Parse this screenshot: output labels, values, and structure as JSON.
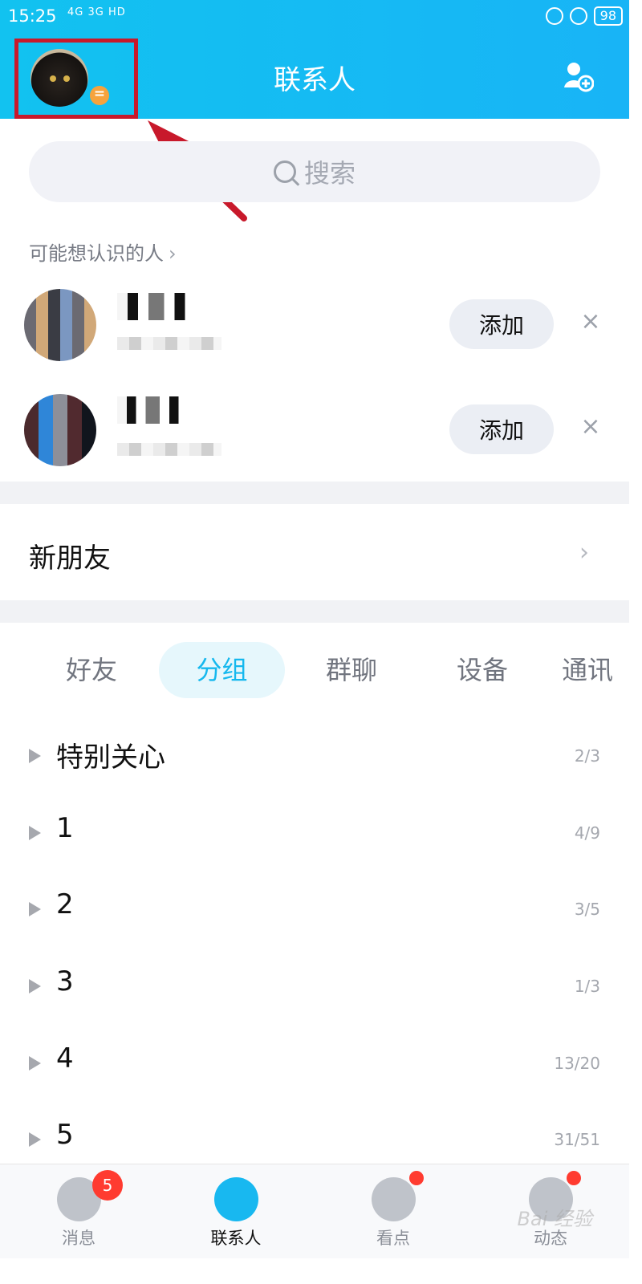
{
  "status_bar": {
    "time": "15:25",
    "signals": "4G 3G HD",
    "battery": "98"
  },
  "header": {
    "title": "联系人"
  },
  "search": {
    "placeholder": "搜索"
  },
  "suggestions": {
    "title": "可能想认识的人",
    "items": [
      {
        "button": "添加"
      },
      {
        "button": "添加"
      }
    ]
  },
  "new_friends": {
    "label": "新朋友"
  },
  "tabs": [
    "好友",
    "分组",
    "群聊",
    "设备",
    "通讯"
  ],
  "groups": [
    {
      "name": "特别关心",
      "count": "2/3"
    },
    {
      "name": "1",
      "count": "4/9"
    },
    {
      "name": "2",
      "count": "3/5"
    },
    {
      "name": "3",
      "count": "1/3"
    },
    {
      "name": "4",
      "count": "13/20"
    },
    {
      "name": "5",
      "count": "31/51"
    }
  ],
  "bottom_nav": {
    "items": [
      {
        "label": "消息",
        "badge": "5"
      },
      {
        "label": "联系人"
      },
      {
        "label": "看点"
      },
      {
        "label": "动态"
      }
    ]
  },
  "watermark": "Bai 经验"
}
